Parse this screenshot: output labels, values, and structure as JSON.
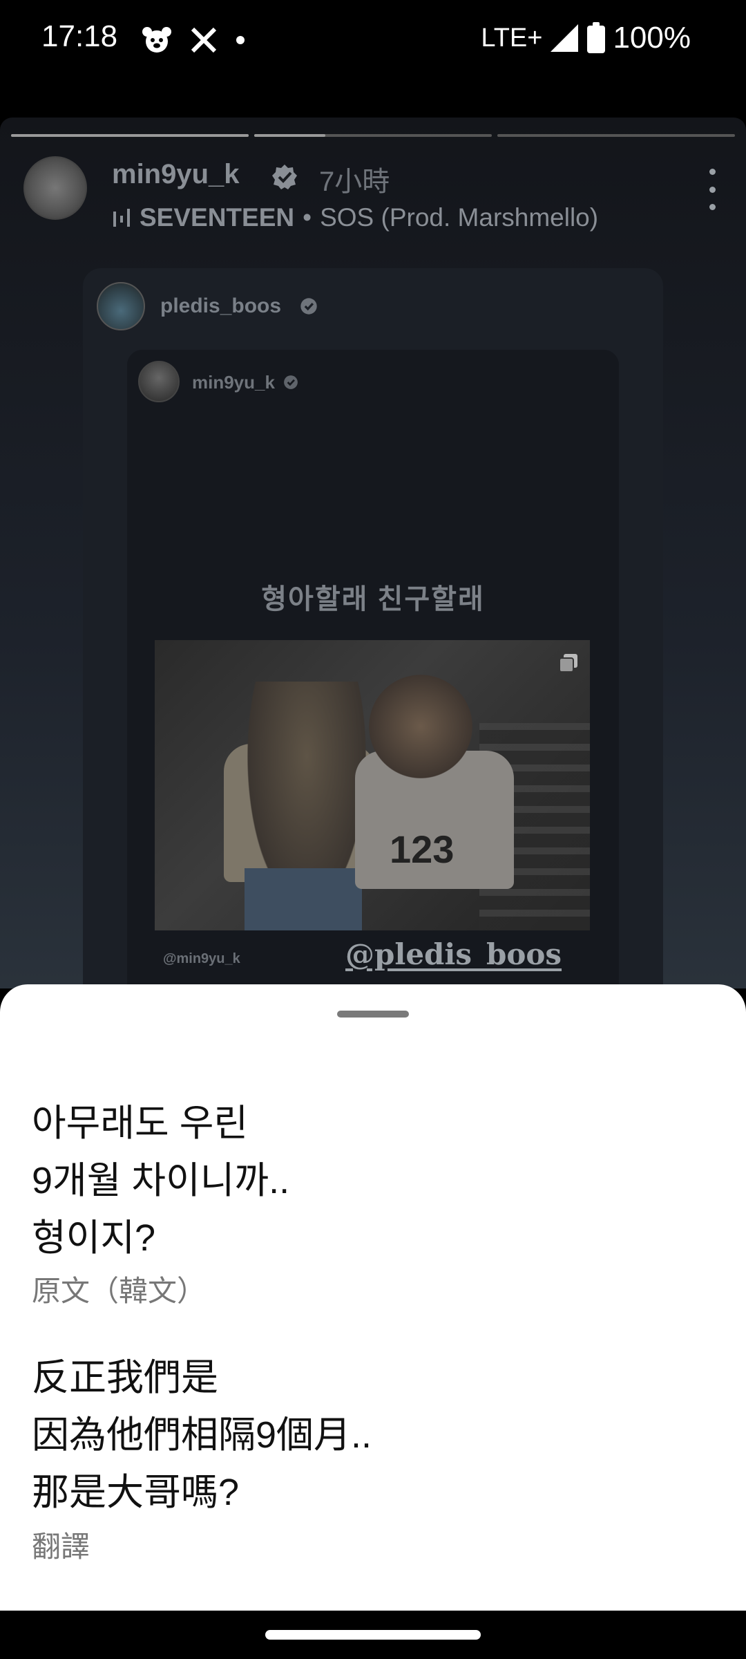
{
  "status_bar": {
    "time": "17:18",
    "network": "LTE+",
    "battery": "100%",
    "left_icons": [
      "bear-icon",
      "x-icon",
      "dot-icon"
    ]
  },
  "story": {
    "progress": [
      1.0,
      0.3,
      0.0
    ],
    "username": "min9yu_k",
    "time_ago": "7小時",
    "music_artist": "SEVENTEEN",
    "music_separator": "•",
    "music_title": "SOS (Prod. Marshmello)"
  },
  "repost": {
    "username": "pledis_boos",
    "inner_username": "min9yu_k",
    "caption": "형아할래  친구할래",
    "photo_number": "123",
    "inner_tag": "@min9yu_k",
    "pledis_tag": "@pledis_boos"
  },
  "sheet": {
    "original_text": "아무래도 우린\n9개월 차이니까..\n형이지?",
    "original_label": "原文（韓文）",
    "translated_text": "反正我們是\n因為他們相隔9個月..\n那是大哥嗎?",
    "translated_label": "翻譯"
  }
}
